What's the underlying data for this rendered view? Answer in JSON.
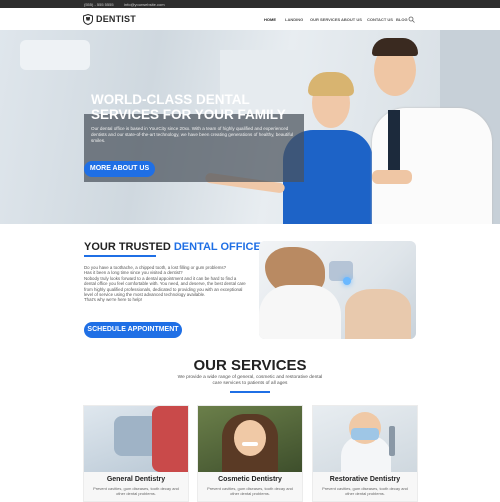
{
  "topbar": {
    "phone": "(555) - 555 5555",
    "email": "info@yourwebsite.com"
  },
  "header": {
    "logo_text": "DENTIST",
    "nav": [
      "HOME",
      "LANDING",
      "OUR SERVICES",
      "ABOUT US",
      "CONTACT US",
      "BLOG"
    ]
  },
  "hero": {
    "title": "WORLD-CLASS DENTAL SERVICES FOR YOUR FAMILY",
    "text": "Our dental office is based in YourCity since 20xx. With a team of highly qualified and experienced dentists and our state-of-the-art technology, we have been creating generations of healthy, beautiful smiles.",
    "button": "MORE ABOUT US"
  },
  "office": {
    "title_plain": "YOUR TRUSTED ",
    "title_accent": "DENTAL OFFICE",
    "paragraphs": [
      "Do you have a toothache, a chipped tooth, a lost filling or gum problems?",
      "Has it been a long time since you visited a dentist?",
      "Nobody truly looks forward to a dental appointment and it can be hard to find a dental office you feel comfortable with. You need, and deserve, the best dental care from highly qualified professionals, dedicated to providing you with an exceptional level of service using the most advanced technology available.",
      "That's why we're here to help!"
    ],
    "button": "SCHEDULE APPOINTMENT"
  },
  "services": {
    "title": "OUR SERVICES",
    "text": "We provide a wide range of general, cosmetic and restorative dental care services to patients of all ages",
    "cards": [
      {
        "title": "General Dentistry",
        "text": "Prevent cavities, gum diseases, tooth decay and other dental problems."
      },
      {
        "title": "Cosmetic Dentistry",
        "text": "Prevent cavities, gum diseases, tooth decay and other dental problems."
      },
      {
        "title": "Restorative Dentistry",
        "text": "Prevent cavities, gum diseases, tooth decay and other dental problems."
      }
    ]
  },
  "colors": {
    "accent": "#1f6fe5",
    "topbar": "#2d2d2d",
    "hero_overlay": "#4a525c"
  }
}
